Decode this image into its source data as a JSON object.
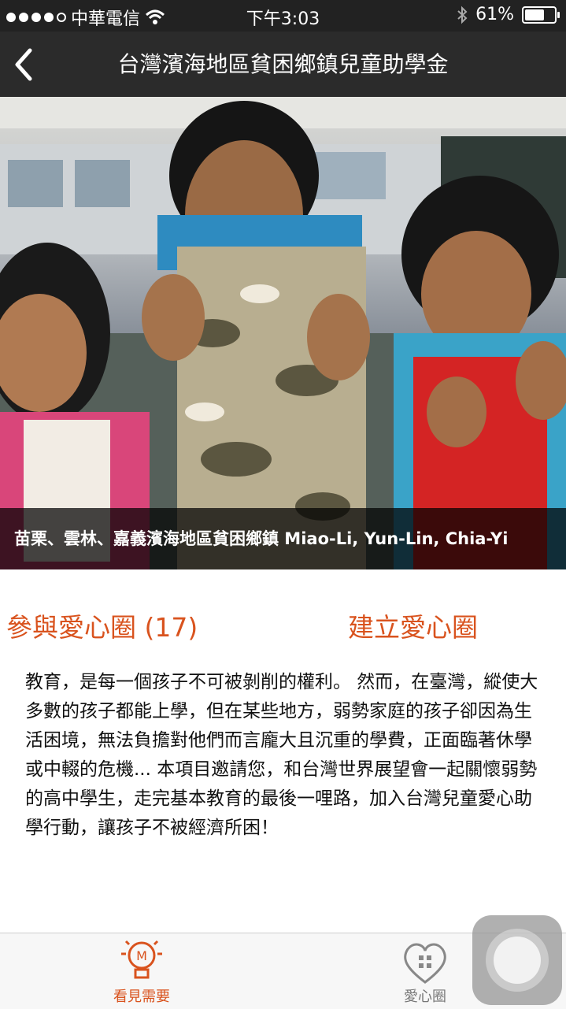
{
  "status_bar": {
    "carrier": "中華電信",
    "time": "下午3:03",
    "battery_percent": "61%",
    "battery_level": 0.61,
    "signal_bars": 4,
    "icons": [
      "signal-dots-icon",
      "wifi-icon",
      "bluetooth-icon",
      "battery-icon"
    ]
  },
  "nav": {
    "title": "台灣濱海地區貧困鄉鎮兒童助學金",
    "back_icon": "chevron-left-icon"
  },
  "hero": {
    "caption": "苗栗、雲林、嘉義濱海地區貧困鄉鎮 Miao-Li, Yun-Lin, Chia-Yi"
  },
  "actions": {
    "join_label": "參與愛心圈 (17)",
    "create_label": "建立愛心圈"
  },
  "description": "教育，是每一個孩子不可被剝削的權利。 然而，在臺灣，縱使大多數的孩子都能上學，但在某些地方，弱勢家庭的孩子卻因為生活困境，無法負擔對他們而言龐大且沉重的學費，正面臨著休學或中輟的危機... 本項目邀請您，和台灣世界展望會一起關懷弱勢的高中學生，走完基本教育的最後一哩路，加入台灣兒童愛心助學行動，讓孩子不被經濟所困！",
  "tab_bar": {
    "tabs": [
      {
        "label": "看見需要",
        "icon": "lightbulb-icon",
        "active": true
      },
      {
        "label": "愛心圈",
        "icon": "heart-icon",
        "active": false
      }
    ]
  },
  "colors": {
    "accent": "#d9531e",
    "nav_bg": "#2b2b2b",
    "status_bg": "#222222"
  }
}
